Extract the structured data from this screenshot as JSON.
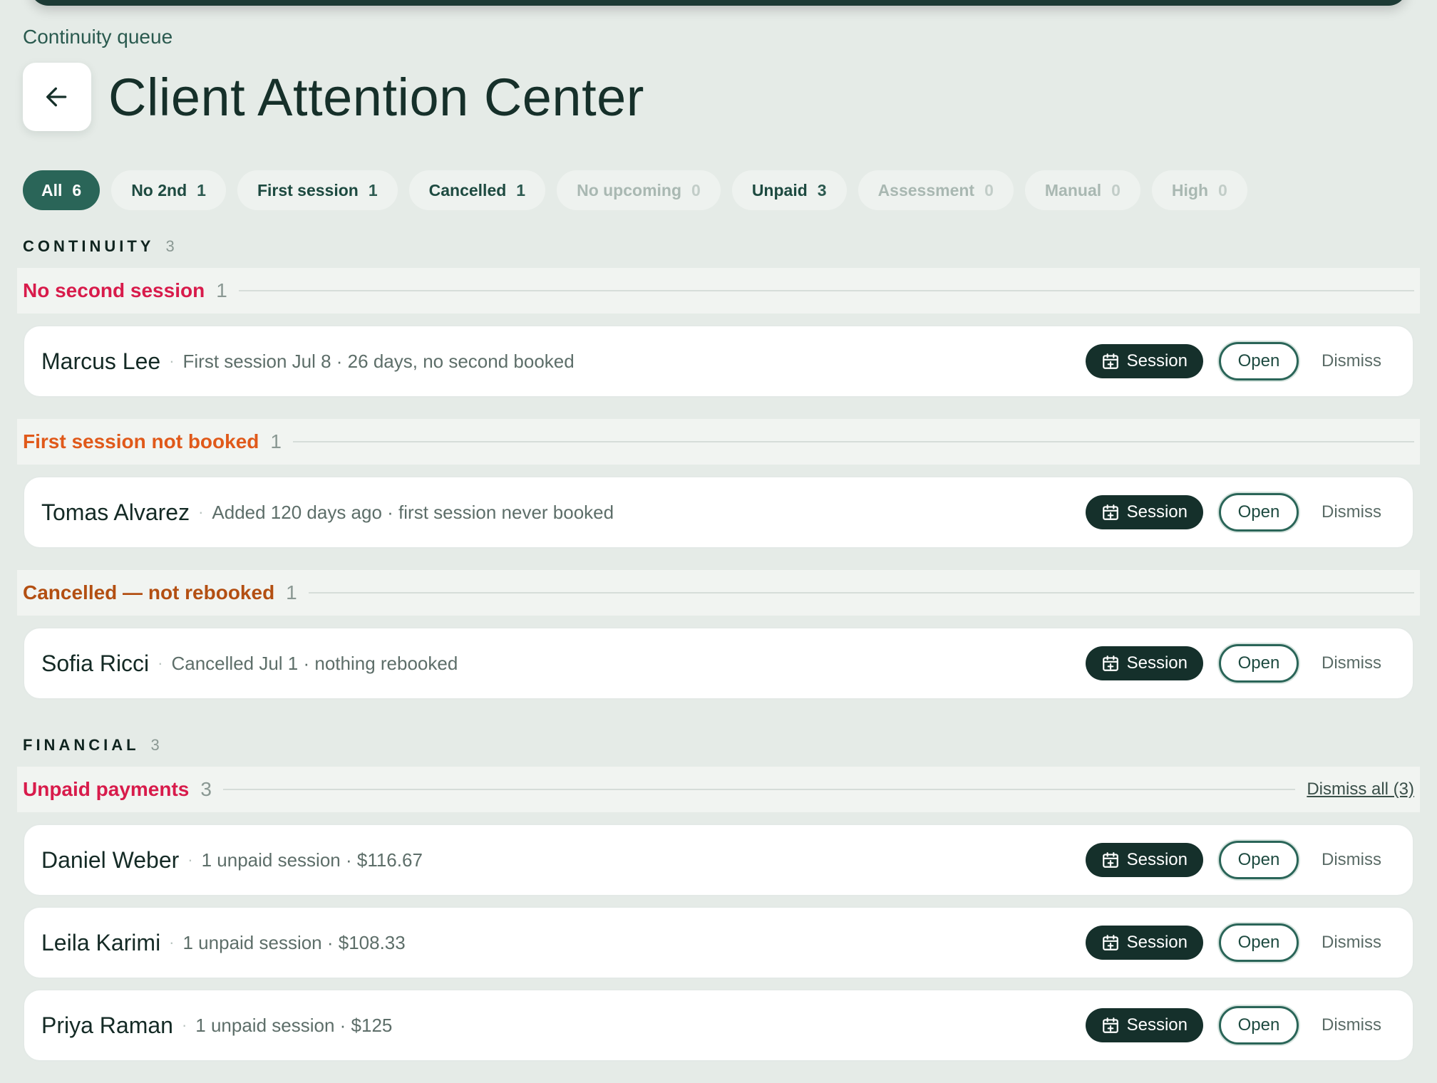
{
  "breadcrumb": "Continuity queue",
  "title": "Client Attention Center",
  "colors": {
    "accent": "#2a6558",
    "dark": "#15302b",
    "red": "#d81b4b",
    "orange": "#e0591a",
    "rust": "#b34f12"
  },
  "icons": {
    "back": "arrow-left-icon",
    "session": "calendar-plus-icon"
  },
  "filters": [
    {
      "label": "All",
      "count": "6",
      "state": "active"
    },
    {
      "label": "No 2nd",
      "count": "1",
      "state": "normal"
    },
    {
      "label": "First session",
      "count": "1",
      "state": "normal"
    },
    {
      "label": "Cancelled",
      "count": "1",
      "state": "normal"
    },
    {
      "label": "No upcoming",
      "count": "0",
      "state": "muted"
    },
    {
      "label": "Unpaid",
      "count": "3",
      "state": "normal"
    },
    {
      "label": "Assessment",
      "count": "0",
      "state": "muted"
    },
    {
      "label": "Manual",
      "count": "0",
      "state": "muted"
    },
    {
      "label": "High",
      "count": "0",
      "state": "muted"
    }
  ],
  "actions": {
    "session": "Session",
    "open": "Open",
    "dismiss": "Dismiss"
  },
  "sections": {
    "continuity": {
      "label": "CONTINUITY",
      "count": "3",
      "groups": [
        {
          "title": "No second session",
          "count": "1",
          "color": "#d81b4b",
          "clients": [
            {
              "name": "Marcus Lee",
              "detail": "First session Jul 8 · 26 days, no second booked"
            }
          ]
        },
        {
          "title": "First session not booked",
          "count": "1",
          "color": "#e0591a",
          "clients": [
            {
              "name": "Tomas Alvarez",
              "detail": "Added 120 days ago · first session never booked"
            }
          ]
        },
        {
          "title": "Cancelled — not rebooked",
          "count": "1",
          "color": "#b34f12",
          "clients": [
            {
              "name": "Sofia Ricci",
              "detail": "Cancelled Jul 1 · nothing rebooked"
            }
          ]
        }
      ]
    },
    "financial": {
      "label": "FINANCIAL",
      "count": "3",
      "groups": [
        {
          "title": "Unpaid payments",
          "count": "3",
          "color": "#d81b4b",
          "dismiss_all": "Dismiss all (3)",
          "clients": [
            {
              "name": "Daniel Weber",
              "detail": "1 unpaid session · $116.67"
            },
            {
              "name": "Leila Karimi",
              "detail": "1 unpaid session · $108.33"
            },
            {
              "name": "Priya Raman",
              "detail": "1 unpaid session · $125"
            }
          ]
        }
      ]
    }
  }
}
